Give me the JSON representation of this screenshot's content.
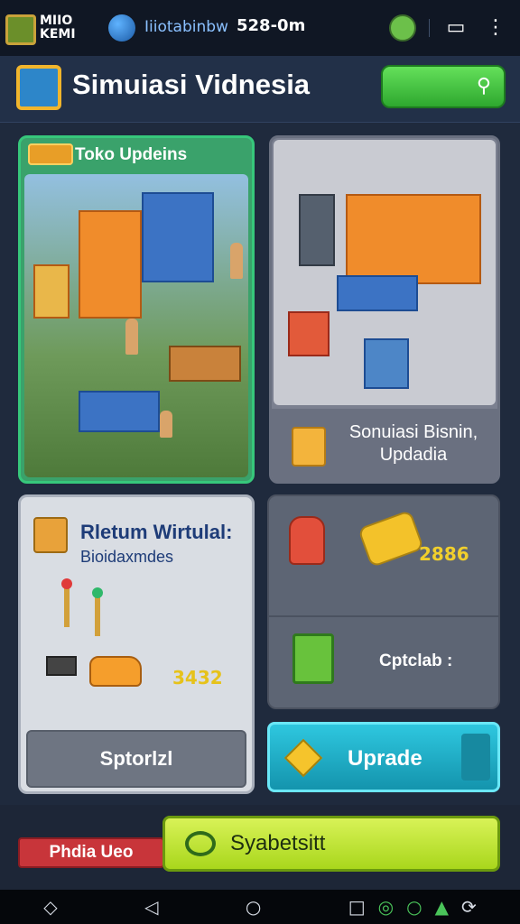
{
  "topbar": {
    "logo_text": "MIIO\nKEMI",
    "network_text": "Iiiotabinbw",
    "network_value": "528-0m"
  },
  "header": {
    "title": "Simuiasi Vidnesia"
  },
  "cards": {
    "store": {
      "title": "Toko Updeins"
    },
    "business": {
      "title": "Sonuiasi Bisnin,\nUpdadia"
    },
    "virtual": {
      "title": "Rletum Wirtulal:",
      "subtitle": "Bioidaxmdes",
      "value": "3432",
      "button": "Sptorlzl"
    },
    "stats": {
      "value": "2886",
      "label": "Cptclab :"
    }
  },
  "actions": {
    "upgrade": "Uprade",
    "left_label": "Phdia Ueo",
    "main": "Syabetsitt"
  },
  "colors": {
    "accent_green": "#2ea82f",
    "accent_cyan": "#1494ad",
    "accent_lime": "#a9d71c",
    "accent_red": "#c8353a"
  },
  "icons": [
    "cube-logo-icon",
    "globe-icon",
    "search-icon",
    "nav-back-icon",
    "nav-home-icon",
    "nav-recents-icon"
  ]
}
